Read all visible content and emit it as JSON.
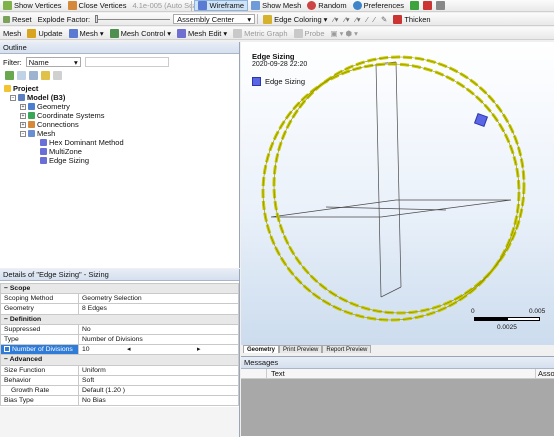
{
  "toolbar1": {
    "show_vertices": "Show Vertices",
    "close_vertices": "Close Vertices",
    "scale_value": "4.1e-005 (Auto Scale)",
    "wireframe": "Wireframe",
    "show_mesh": "Show Mesh",
    "random": "Random",
    "preferences": "Preferences"
  },
  "toolbar2": {
    "reset": "Reset",
    "explode_factor": "Explode Factor:",
    "assembly_center": "Assembly Center",
    "edge_coloring": "Edge Coloring",
    "thicken": "Thicken"
  },
  "toolbar3": {
    "mesh": "Mesh",
    "update": "Update",
    "mesh_menu": "Mesh",
    "mesh_control": "Mesh Control",
    "mesh_edit": "Mesh Edit",
    "metric_graph": "Metric Graph",
    "probe": "Probe"
  },
  "outline": {
    "title": "Outline",
    "filter_label": "Filter:",
    "filter_value": "Name",
    "tree": {
      "project": "Project",
      "model": "Model (B3)",
      "geometry": "Geometry",
      "coordinate_systems": "Coordinate Systems",
      "connections": "Connections",
      "mesh": "Mesh",
      "hex_dominant": "Hex Dominant Method",
      "multizone": "MultiZone",
      "edge_sizing": "Edge Sizing"
    }
  },
  "details": {
    "title": "Details of \"Edge Sizing\" - Sizing",
    "scope_header": "Scope",
    "scoping_method_k": "Scoping Method",
    "scoping_method_v": "Geometry Selection",
    "geometry_k": "Geometry",
    "geometry_v": "8 Edges",
    "definition_header": "Definition",
    "suppressed_k": "Suppressed",
    "suppressed_v": "No",
    "type_k": "Type",
    "type_v": "Number of Divisions",
    "num_div_k": "Number of Divisions",
    "num_div_v": "10",
    "advanced_header": "Advanced",
    "size_function_k": "Size Function",
    "size_function_v": "Uniform",
    "behavior_k": "Behavior",
    "behavior_v": "Soft",
    "growth_rate_k": "Growth Rate",
    "growth_rate_v": "Default (1.20 )",
    "bias_type_k": "Bias Type",
    "bias_type_v": "No Bias"
  },
  "viewport": {
    "title": "Edge Sizing",
    "date": "2020-09-28 22:20",
    "legend": "Edge Sizing",
    "scale_0": "0",
    "scale_mid": "0.0025",
    "scale_max": "0.005",
    "tabs": [
      "Geometry",
      "Print Preview",
      "Report Preview"
    ]
  },
  "messages": {
    "title": "Messages",
    "col_text": "Text",
    "col_assoc": "Asso"
  },
  "colors": {
    "edge": "#c7c700",
    "edge_dash": "#8a8a00",
    "accent": "#2f7bd8",
    "legend_swatch": "#5a66e6"
  }
}
